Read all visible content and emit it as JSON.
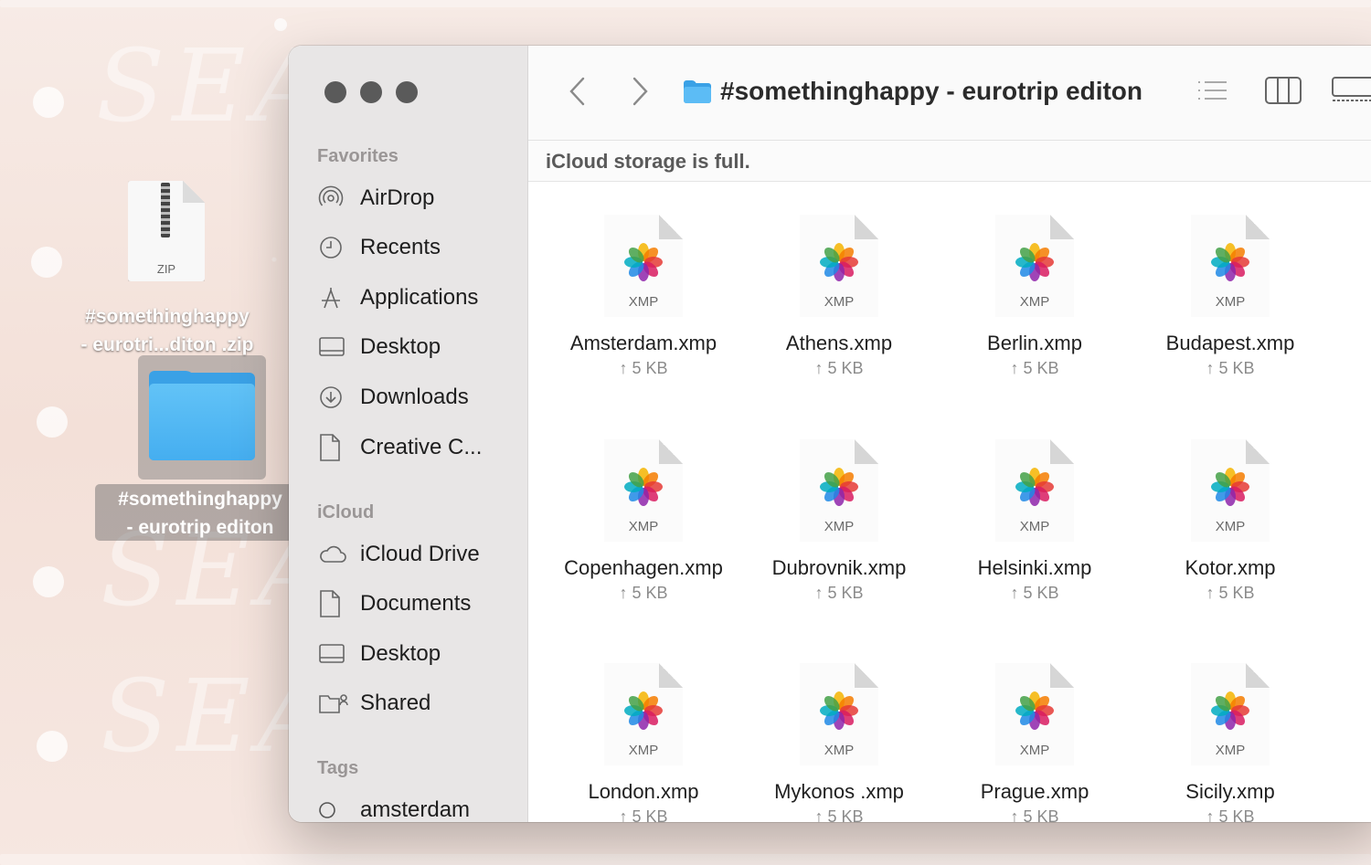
{
  "desktop": {
    "zip_icon_label": "ZIP",
    "zip_caption_line1": "#somethinghappy",
    "zip_caption_line2": "- eurotri...diton .zip",
    "folder_caption_line1": "#somethinghappy",
    "folder_caption_line2": "- eurotrip editon",
    "watermark": "SEA"
  },
  "window": {
    "title": "#somethinghappy - eurotrip editon",
    "banner": "iCloud storage is full.",
    "toolbar": {
      "back_icon": "chevron-left-icon",
      "forward_icon": "chevron-right-icon",
      "list_view_icon": "list-view-icon",
      "column_view_icon": "column-view-icon",
      "gallery_view_icon": "gallery-view-icon"
    }
  },
  "sidebar": {
    "favorites_heading": "Favorites",
    "favorites": [
      {
        "label": "AirDrop",
        "icon": "airdrop-icon"
      },
      {
        "label": "Recents",
        "icon": "clock-icon"
      },
      {
        "label": "Applications",
        "icon": "applications-icon"
      },
      {
        "label": "Desktop",
        "icon": "desktop-icon"
      },
      {
        "label": "Downloads",
        "icon": "download-icon"
      },
      {
        "label": "Creative C...",
        "icon": "document-icon"
      }
    ],
    "icloud_heading": "iCloud",
    "icloud": [
      {
        "label": "iCloud Drive",
        "icon": "cloud-icon"
      },
      {
        "label": "Documents",
        "icon": "document-icon"
      },
      {
        "label": "Desktop",
        "icon": "desktop-icon"
      },
      {
        "label": "Shared",
        "icon": "shared-folder-icon"
      }
    ],
    "tags_heading": "Tags",
    "tags": [
      {
        "label": "amsterdam",
        "icon": "tag-circle-icon"
      }
    ]
  },
  "files": [
    {
      "name": "Amsterdam.xmp",
      "ext": "XMP",
      "size": "↑ 5 KB"
    },
    {
      "name": "Athens.xmp",
      "ext": "XMP",
      "size": "↑ 5 KB"
    },
    {
      "name": "Berlin.xmp",
      "ext": "XMP",
      "size": "↑ 5 KB"
    },
    {
      "name": "Budapest.xmp",
      "ext": "XMP",
      "size": "↑ 5 KB"
    },
    {
      "name": "Copenhagen.xmp",
      "ext": "XMP",
      "size": "↑ 5 KB"
    },
    {
      "name": "Dubrovnik.xmp",
      "ext": "XMP",
      "size": "↑ 5 KB"
    },
    {
      "name": "Helsinki.xmp",
      "ext": "XMP",
      "size": "↑ 5 KB"
    },
    {
      "name": "Kotor.xmp",
      "ext": "XMP",
      "size": "↑ 5 KB"
    },
    {
      "name": "London.xmp",
      "ext": "XMP",
      "size": "↑ 5 KB"
    },
    {
      "name": "Mykonos .xmp",
      "ext": "XMP",
      "size": "↑ 5 KB"
    },
    {
      "name": "Prague.xmp",
      "ext": "XMP",
      "size": "↑ 5 KB"
    },
    {
      "name": "Sicily.xmp",
      "ext": "XMP",
      "size": "↑ 5 KB"
    }
  ],
  "colors": {
    "folder_blue": "#3aa1e6",
    "sidebar_bg": "#e8e6e6",
    "traffic_light": "#5a5a5a"
  }
}
